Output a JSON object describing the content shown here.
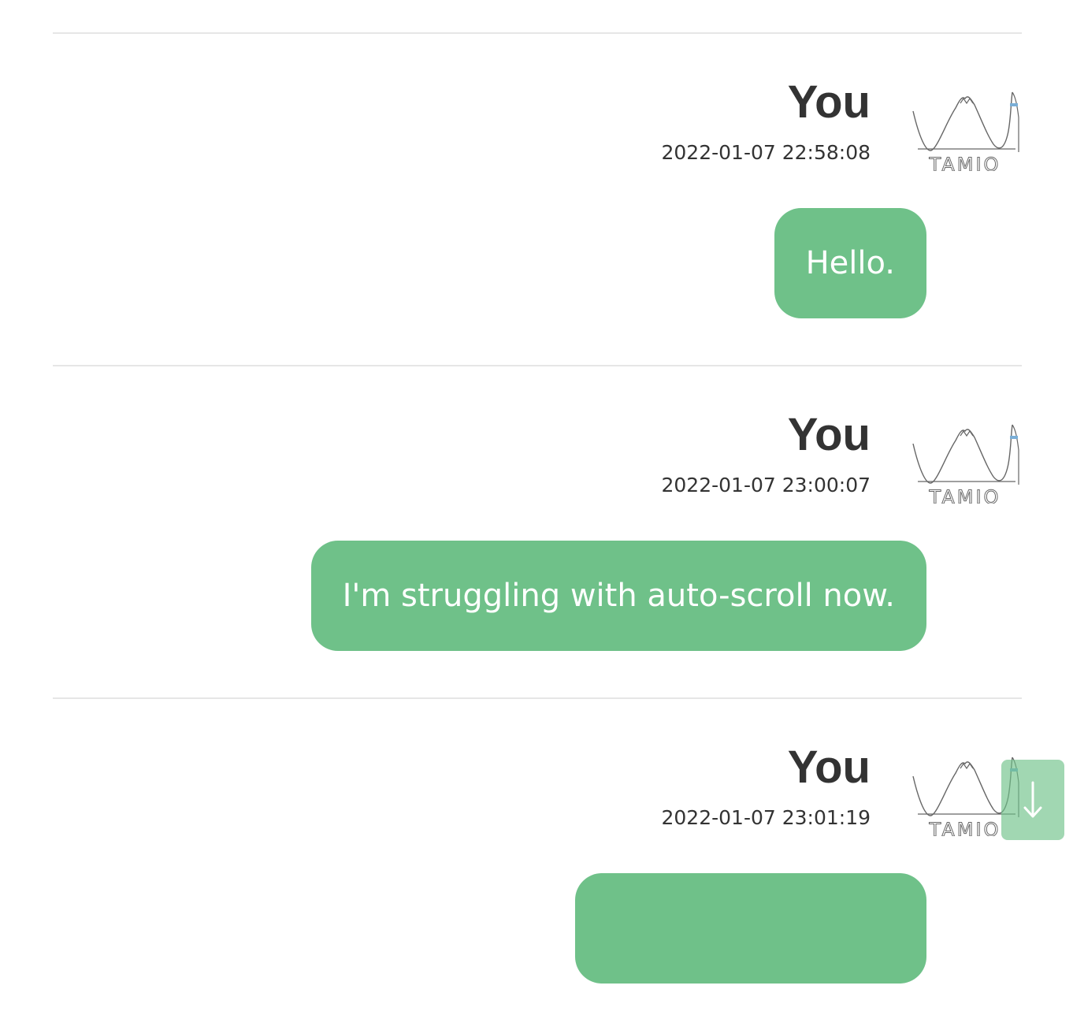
{
  "messages": [
    {
      "sender": "You",
      "timestamp": "2022-01-07 22:58:08",
      "text": "Hello.",
      "avatar_text": "TAMIO"
    },
    {
      "sender": "You",
      "timestamp": "2022-01-07 23:00:07",
      "text": "I'm struggling with auto-scroll now.",
      "avatar_text": "TAMIO"
    },
    {
      "sender": "You",
      "timestamp": "2022-01-07 23:01:19",
      "text": "",
      "avatar_text": "TAMIO"
    }
  ],
  "scroll_button": {
    "icon": "arrow-down-icon",
    "glyph": "↓"
  },
  "colors": {
    "bubble": "#6fc189",
    "scroll_button": "#a3dcb8",
    "divider": "#e6e6e6",
    "text": "#333333"
  }
}
